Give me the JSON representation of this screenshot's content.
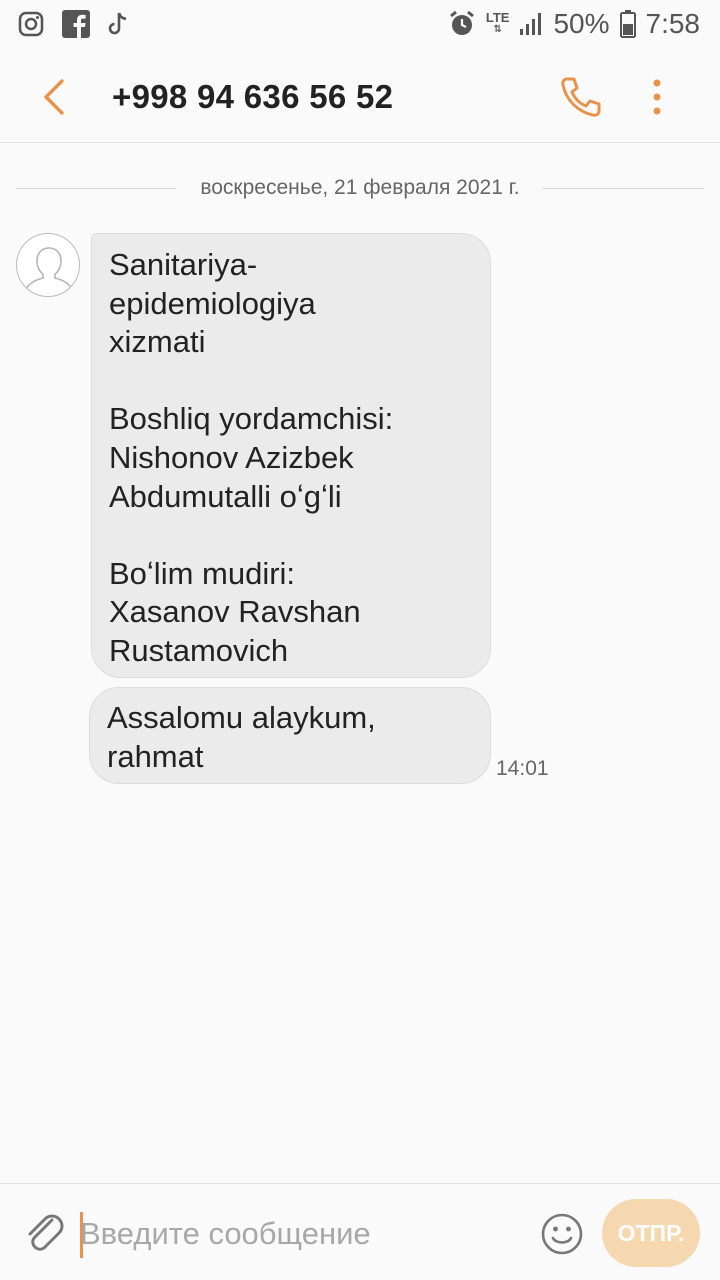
{
  "status_bar": {
    "icons": [
      "instagram-icon",
      "facebook-icon",
      "tiktok-icon",
      "alarm-icon",
      "lte-icon",
      "signal-icon",
      "battery-icon"
    ],
    "network": "LTE",
    "battery": "50%",
    "time": "7:58"
  },
  "header": {
    "contact": "+998 94 636 56 52",
    "accent_color": "#e8924a"
  },
  "conversation": {
    "date_separator": "воскресенье, 21 февраля 2021 г.",
    "messages": [
      {
        "text": "Sanitariya-\nepidemiologiya\nxizmati\n\nBoshliq yordamchisi:\nNishonov Azizbek\nAbdumutalli oʻgʻli\n\nBoʻlim mudiri:\nXasanov Ravshan\nRustamovich"
      },
      {
        "text": "Assalomu alaykum,\nrahmat",
        "time": "14:01"
      }
    ]
  },
  "composer": {
    "placeholder": "Введите сообщение",
    "value": "",
    "send_label": "ОТПР."
  }
}
